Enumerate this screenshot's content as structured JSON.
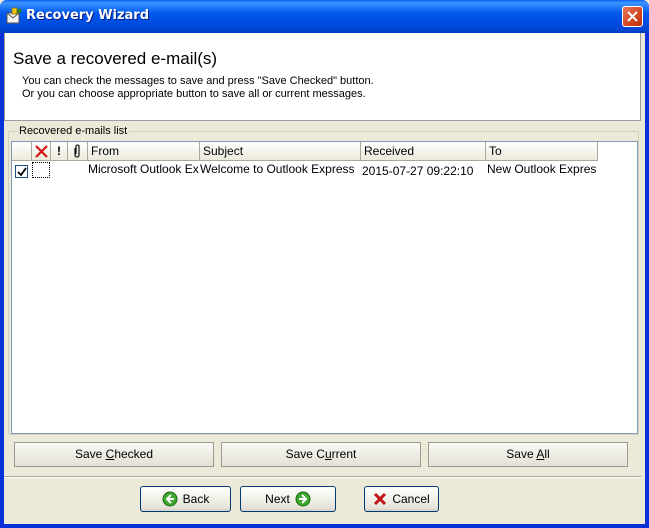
{
  "window": {
    "title": "Recovery Wizard"
  },
  "header": {
    "title": "Save a recovered e-mail(s)",
    "desc_line1": "You can check the messages to save and press \"Save Checked\" button.",
    "desc_line2": "Or you can choose appropriate button to save all or current messages."
  },
  "group": {
    "label": "Recovered e-mails list"
  },
  "list": {
    "columns": {
      "deleted_icon": "red-x-icon",
      "priority": "!",
      "attachment_icon": "paperclip-icon",
      "from": "From",
      "subject": "Subject",
      "received": "Received",
      "to": "To"
    },
    "rows": [
      {
        "checked": true,
        "from": "Microsoft Outlook Ex",
        "subject": "Welcome to Outlook Express",
        "received": "2015-07-27 09:22:10",
        "to": "New Outlook Expres"
      }
    ]
  },
  "actions": {
    "save_checked_pre": "Save ",
    "save_checked_u": "C",
    "save_checked_post": "hecked",
    "save_current_pre": "Save C",
    "save_current_u": "u",
    "save_current_post": "rrent",
    "save_all_pre": "Save ",
    "save_all_u": "A",
    "save_all_post": "ll"
  },
  "nav": {
    "back": "Back",
    "next": "Next",
    "cancel": "Cancel"
  },
  "colors": {
    "titlebar": "#0058EE",
    "face": "#ECE9D8",
    "accent_green": "#3DA82E",
    "cancel_red": "#C0141A"
  }
}
